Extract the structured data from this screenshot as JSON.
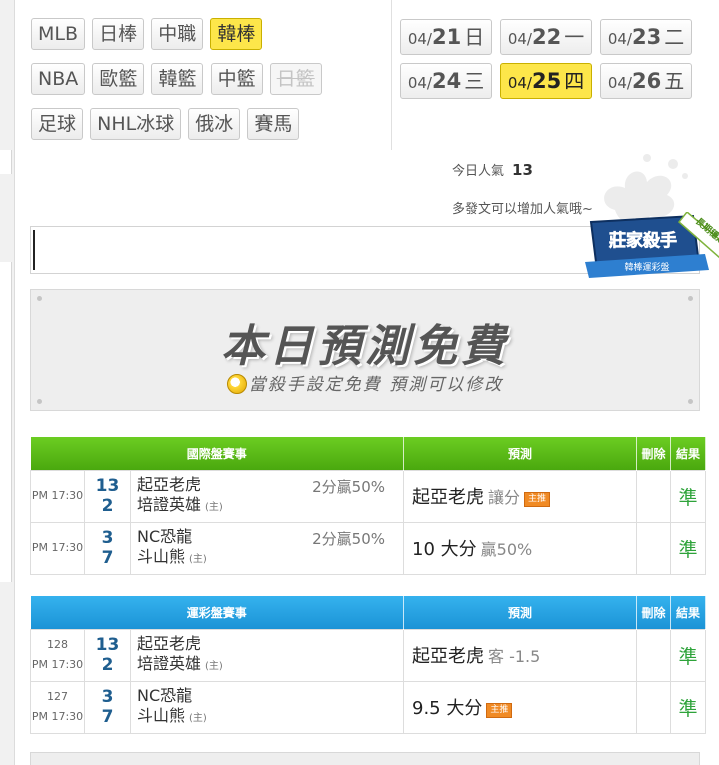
{
  "sports": {
    "row1": [
      {
        "label": "MLB",
        "state": "normal"
      },
      {
        "label": "日棒",
        "state": "normal"
      },
      {
        "label": "中職",
        "state": "normal"
      },
      {
        "label": "韓棒",
        "state": "active"
      }
    ],
    "row2": [
      {
        "label": "NBA",
        "state": "normal"
      },
      {
        "label": "歐籃",
        "state": "normal"
      },
      {
        "label": "韓籃",
        "state": "normal"
      },
      {
        "label": "中籃",
        "state": "normal"
      },
      {
        "label": "日籃",
        "state": "disabled"
      }
    ],
    "row3": [
      {
        "label": "足球",
        "state": "normal"
      },
      {
        "label": "NHL冰球",
        "state": "normal"
      },
      {
        "label": "俄冰",
        "state": "normal"
      },
      {
        "label": "賽馬",
        "state": "normal"
      }
    ]
  },
  "dates": [
    {
      "md": "04/",
      "day": "21",
      "wd": "日",
      "active": false
    },
    {
      "md": "04/",
      "day": "22",
      "wd": "一",
      "active": false
    },
    {
      "md": "04/",
      "day": "23",
      "wd": "二",
      "active": false
    },
    {
      "md": "04/",
      "day": "24",
      "wd": "三",
      "active": false
    },
    {
      "md": "04/",
      "day": "25",
      "wd": "四",
      "active": true
    },
    {
      "md": "04/",
      "day": "26",
      "wd": "五",
      "active": false
    }
  ],
  "popularity": {
    "label": "今日人氣",
    "value": "13",
    "hint": "多發文可以增加人氣哦~"
  },
  "badge": {
    "name": "莊家殺手",
    "subtitle": "韓棒運彩盤",
    "ribbon": "長期穩定"
  },
  "post_input": {
    "value": "",
    "placeholder": ""
  },
  "banner": {
    "title": "本日預測免費",
    "subtitle": "當殺手設定免費 預測可以修改"
  },
  "intl_table": {
    "headers": {
      "events": "國際盤賽事",
      "prediction": "預測",
      "delete": "刪除",
      "result": "結果"
    },
    "rows": [
      {
        "time": "PM 17:30",
        "away_score": "13",
        "away_team": "起亞老虎",
        "home_score": "2",
        "home_team": "培證英雄",
        "home_mark": "(主)",
        "odds": "2分贏50%",
        "pred_main": "起亞老虎",
        "pred_sub": "讓分",
        "pred_tag": "主推",
        "result": "準"
      },
      {
        "time": "PM 17:30",
        "away_score": "3",
        "away_team": "NC恐龍",
        "home_score": "7",
        "home_team": "斗山熊",
        "home_mark": "(主)",
        "odds": "2分贏50%",
        "pred_main": "10 大分",
        "pred_sub": "贏50%",
        "pred_tag": "",
        "result": "準"
      }
    ]
  },
  "sports_lottery_table": {
    "headers": {
      "events": "運彩盤賽事",
      "prediction": "預測",
      "delete": "刪除",
      "result": "結果"
    },
    "rows": [
      {
        "code": "128",
        "time": "PM 17:30",
        "away_score": "13",
        "away_team": "起亞老虎",
        "home_score": "2",
        "home_team": "培證英雄",
        "home_mark": "(主)",
        "pred_main": "起亞老虎",
        "pred_sub": "客 -1.5",
        "pred_tag": "",
        "result": "準"
      },
      {
        "code": "127",
        "time": "PM 17:30",
        "away_score": "3",
        "away_team": "NC恐龍",
        "home_score": "7",
        "home_team": "斗山熊",
        "home_mark": "(主)",
        "pred_main": "9.5 大分",
        "pred_sub": "",
        "pred_tag": "主推",
        "result": "準"
      }
    ]
  },
  "colors": {
    "active_yellow": "#fde64a",
    "green_header": "#4aa80e",
    "blue_header": "#1b93d6",
    "result_green": "#2ea33a",
    "tag_orange": "#f08a24"
  }
}
